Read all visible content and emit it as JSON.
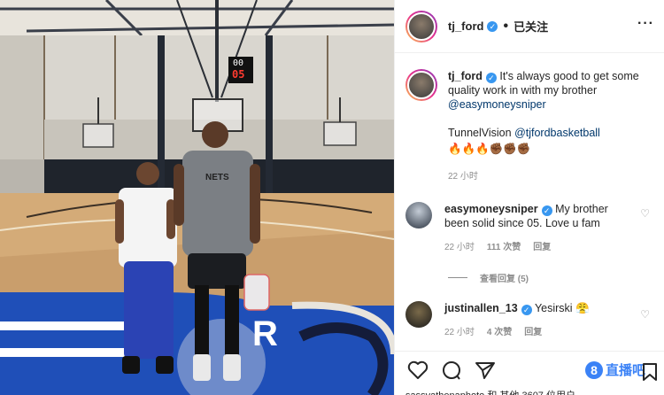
{
  "header": {
    "username": "tj_ford",
    "separator": "•",
    "follow_label": "已关注",
    "more_icon": "more-horizontal-icon"
  },
  "caption": {
    "username": "tj_ford",
    "text": "It's always good to get some quality work in with my brother",
    "mention": "@easymoneysniper",
    "hashtag_prefix": "TunnelVision",
    "mention2": "@tjfordbasketball",
    "emojis": "🔥🔥🔥✊🏾✊🏾✊🏾",
    "time": "22 小时"
  },
  "comments": [
    {
      "username": "easymoneysniper",
      "text": "My brother been solid since 05. Love u fam",
      "time": "22 小时",
      "likes": "111 次赞",
      "reply": "回复"
    },
    {
      "username": "justinallen_13",
      "text": "Yesirski",
      "emoji": "😤",
      "time": "22 小时",
      "likes": "4 次赞",
      "reply": "回复"
    }
  ],
  "view_replies": "查看回复 (5)",
  "liked_by": "sassyathenaphoto 和 其他 3607 位用户",
  "watermark": {
    "badge": "8",
    "text": "直播吧"
  },
  "photo": {
    "scoreboard_top": "00",
    "scoreboard_bottom": "05",
    "shirt_text": "NETS",
    "floor_text": "R"
  },
  "colors": {
    "verified": "#3897f0",
    "link": "#00376b",
    "meta": "#8e8e8e",
    "court_blue": "#1f4fb8",
    "watermark": "#3b82f6"
  }
}
